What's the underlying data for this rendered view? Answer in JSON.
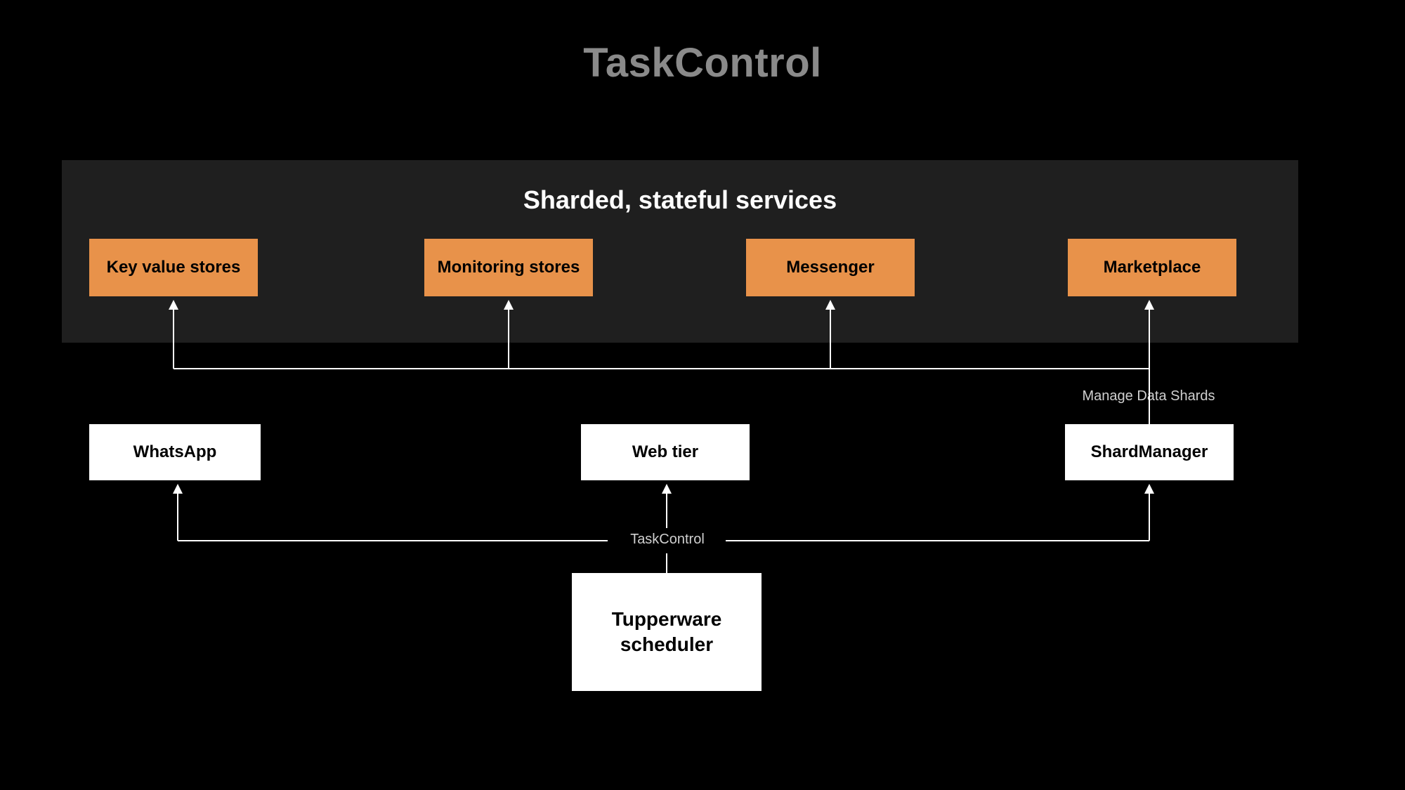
{
  "title": "TaskControl",
  "panel": {
    "title": "Sharded, stateful services",
    "services": [
      {
        "id": "kv",
        "label": "Key value stores"
      },
      {
        "id": "monitoring",
        "label": "Monitoring stores"
      },
      {
        "id": "messenger",
        "label": "Messenger"
      },
      {
        "id": "marketplace",
        "label": "Marketplace"
      }
    ]
  },
  "middle_row": [
    {
      "id": "whatsapp",
      "label": "WhatsApp"
    },
    {
      "id": "webtier",
      "label": "Web tier"
    },
    {
      "id": "shardmanager",
      "label": "ShardManager"
    }
  ],
  "scheduler": {
    "label": "Tupperware\nscheduler"
  },
  "edge_labels": {
    "shardmanager_to_services": "Manage Data Shards",
    "scheduler_to_middle": "TaskControl"
  },
  "colors": {
    "background": "#000000",
    "panel": "#1f1f1f",
    "orange": "#e8924a",
    "white": "#ffffff",
    "title_grey": "#8a8a8a"
  }
}
